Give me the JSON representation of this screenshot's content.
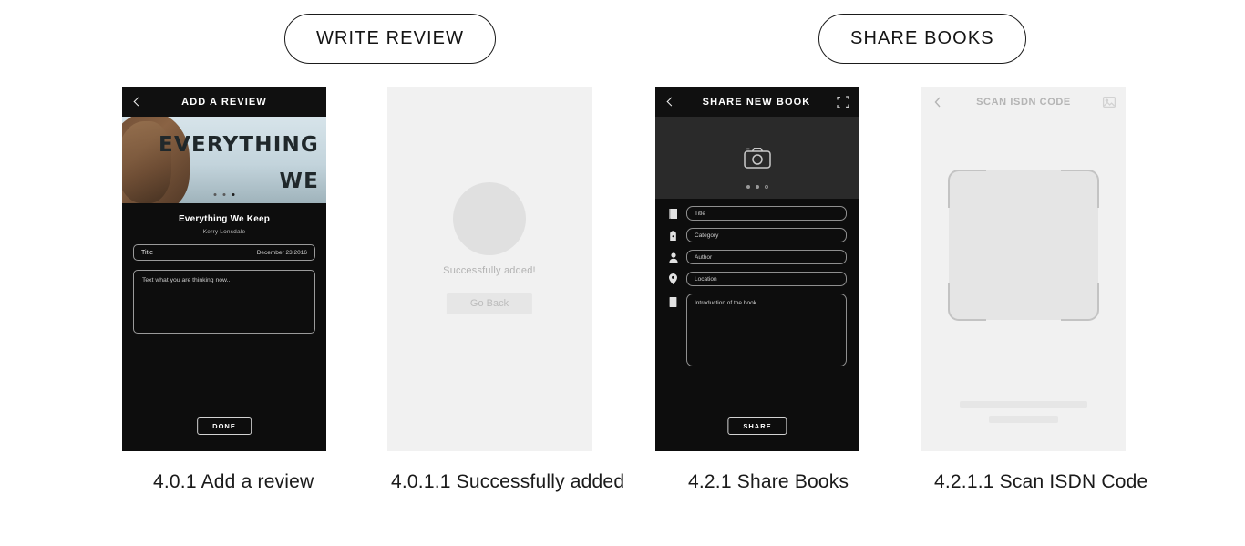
{
  "toolbar": {
    "write_review_label": "WRITE REVIEW",
    "share_books_label": "SHARE BOOKS"
  },
  "screens": [
    {
      "caption": "4.0.1 Add a review",
      "theme": "dark",
      "header": {
        "back_icon": "chevron-left-icon",
        "title": "ADD A REVIEW"
      },
      "cover": {
        "line1": "EVERYTHING",
        "line2": "WE",
        "dots": 3,
        "active_dot": 3
      },
      "book": {
        "title": "Everything We Keep",
        "author": "Kerry Lonsdale"
      },
      "title_field": {
        "placeholder": "Title",
        "date": "December 23.2016"
      },
      "review_field": {
        "placeholder": "Text what you are thinking now.."
      },
      "done_label": "DONE"
    },
    {
      "caption": "4.0.1.1 Successfully added",
      "theme": "light",
      "message": "Successfully added!",
      "button_label": "Go Back"
    },
    {
      "caption": "4.2.1 Share Books",
      "theme": "dark",
      "header": {
        "back_icon": "chevron-left-icon",
        "title": "SHARE NEW BOOK",
        "action_icon": "expand-icon"
      },
      "photo": {
        "camera_icon": "camera-icon",
        "dots": 3,
        "active_dots": 2
      },
      "fields": [
        {
          "icon": "book-icon",
          "placeholder": "Title"
        },
        {
          "icon": "tag-icon",
          "placeholder": "Category"
        },
        {
          "icon": "person-icon",
          "placeholder": "Author"
        },
        {
          "icon": "location-pin-icon",
          "placeholder": "Location"
        }
      ],
      "intro_field": {
        "icon": "document-icon",
        "placeholder": "Introduction of the book..."
      },
      "share_label": "SHARE"
    },
    {
      "caption": "4.2.1.1 Scan ISDN Code",
      "theme": "light",
      "header": {
        "back_icon": "chevron-left-icon",
        "title": "SCAN ISDN CODE",
        "action_icon": "gallery-icon"
      },
      "scan_frame": "scan-target-frame"
    }
  ],
  "colors": {
    "page_background": "#ffffff",
    "dark_screen": "#0d0d0d",
    "light_screen": "#f1f1f1",
    "placeholder_grey": "#e0e0e0",
    "text_dark": "#1a1a1a"
  }
}
